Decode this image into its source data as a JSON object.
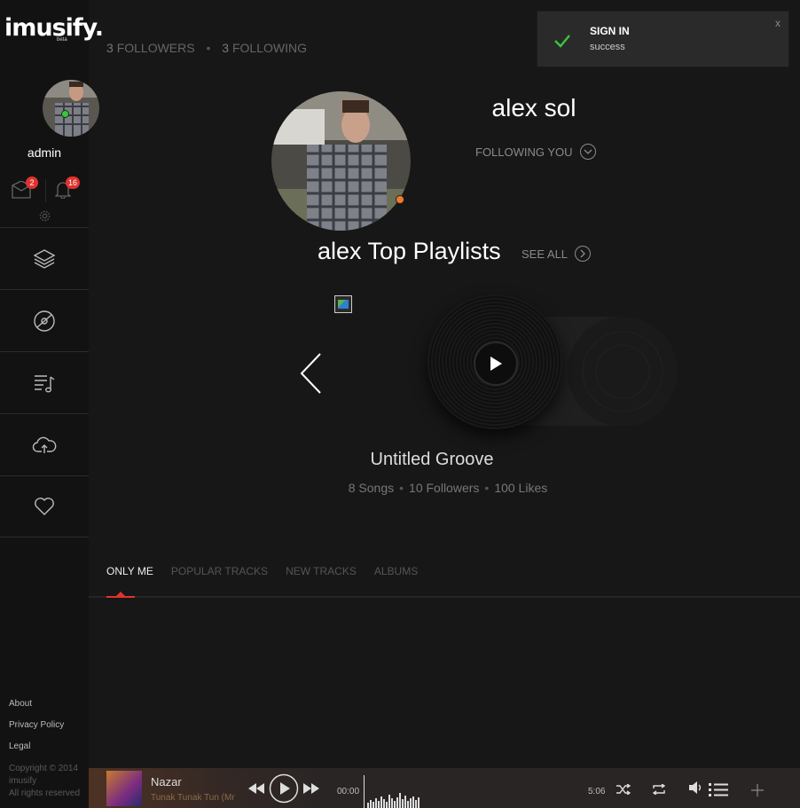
{
  "sidebar": {
    "logo": "imusify.",
    "logo_beta": "beta",
    "username": "admin",
    "messages_badge": "2",
    "notifications_badge": "16",
    "nav": [
      {
        "name": "nav-layers",
        "icon": "layers-icon"
      },
      {
        "name": "nav-vinyl",
        "icon": "vinyl-icon"
      },
      {
        "name": "nav-playlist",
        "icon": "playlist-icon"
      },
      {
        "name": "nav-upload",
        "icon": "cloud-upload-icon"
      },
      {
        "name": "nav-likes",
        "icon": "heart-icon"
      }
    ],
    "footer_links": [
      "About",
      "Privacy Policy",
      "Legal"
    ],
    "copyright": "Copyright © 2014 imusify",
    "rights": "All rights reserved"
  },
  "stats": {
    "followers_count": "3",
    "followers_label": "FOLLOWERS",
    "following_count": "3",
    "following_label": "FOLLOWING"
  },
  "profile": {
    "name": "alex sol",
    "following_you": "FOLLOWING YOU"
  },
  "playlists": {
    "title": "alex Top Playlists",
    "see_all": "SEE ALL",
    "current": {
      "title": "Untitled Groove",
      "songs": "8 Songs",
      "followers": "10 Followers",
      "likes": "100 Likes"
    }
  },
  "tabs": [
    {
      "label": "ONLY ME",
      "active": true
    },
    {
      "label": "POPULAR TRACKS",
      "active": false
    },
    {
      "label": "NEW TRACKS",
      "active": false
    },
    {
      "label": "ALBUMS",
      "active": false
    }
  ],
  "toast": {
    "title": "SIGN IN",
    "message": "success",
    "close": "x"
  },
  "player": {
    "track_title": "Nazar",
    "track_artist": "Tunak Tunak Tun (Mr",
    "elapsed": "00:00",
    "duration": "5:06"
  },
  "colors": {
    "accent": "#e0322f",
    "online": "#3ec43e",
    "away": "#f07c28"
  }
}
